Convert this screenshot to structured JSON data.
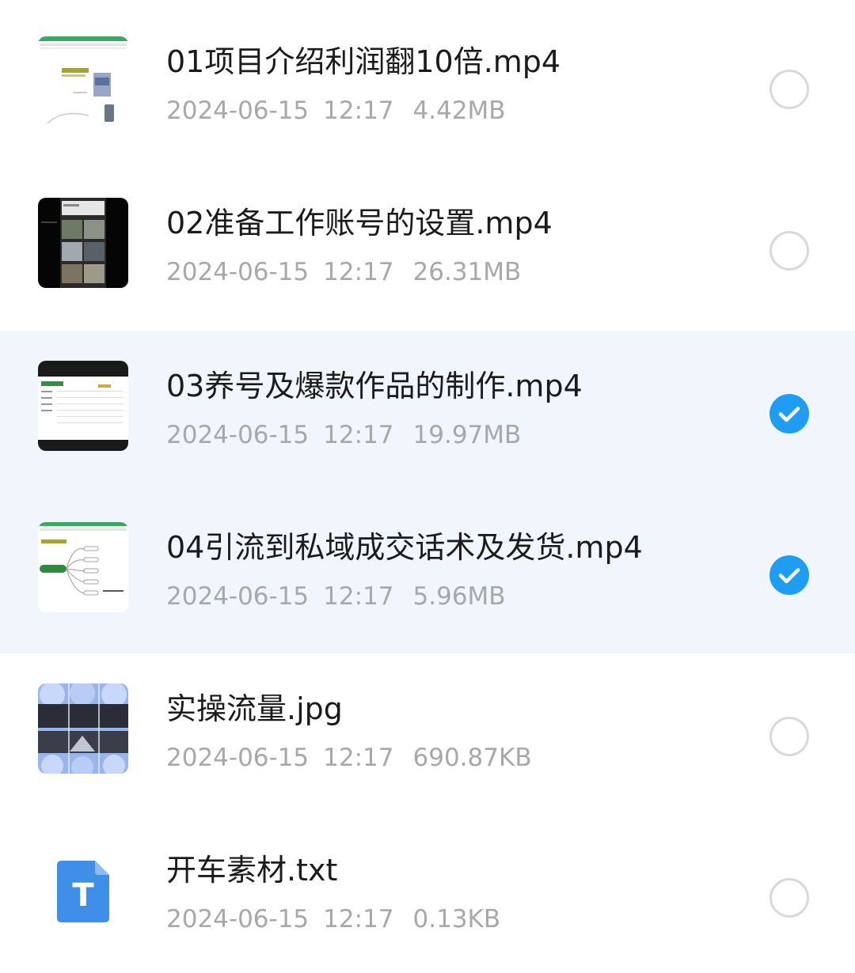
{
  "files": [
    {
      "name": "01项目介绍利润翻10倍.mp4",
      "date": "2024-06-15",
      "time": "12:17",
      "size": "4.42MB",
      "selected": false,
      "thumbnail": "spreadsheet-screenshot"
    },
    {
      "name": "02准备工作账号的设置.mp4",
      "date": "2024-06-15",
      "time": "12:17",
      "size": "26.31MB",
      "selected": false,
      "thumbnail": "phone-video-screenshot"
    },
    {
      "name": "03养号及爆款作品的制作.mp4",
      "date": "2024-06-15",
      "time": "12:17",
      "size": "19.97MB",
      "selected": true,
      "thumbnail": "desktop-table-screenshot"
    },
    {
      "name": "04引流到私域成交话术及发货.mp4",
      "date": "2024-06-15",
      "time": "12:17",
      "size": "5.96MB",
      "selected": true,
      "thumbnail": "mind-map-screenshot"
    },
    {
      "name": "实操流量.jpg",
      "date": "2024-06-15",
      "time": "12:17",
      "size": "690.87KB",
      "selected": false,
      "thumbnail": "video-grid-image"
    },
    {
      "name": "开车素材.txt",
      "date": "2024-06-15",
      "time": "12:17",
      "size": "0.13KB",
      "selected": false,
      "thumbnail": "txt-file-icon",
      "icon_letter": "T"
    }
  ],
  "colors": {
    "selected_row_bg": "#f1f6fc",
    "checkbox_checked": "#1e9df2",
    "checkbox_unchecked_border": "#d9d9d9",
    "name_text": "#1b1b1b",
    "meta_text": "#a8a8a8",
    "txt_icon": "#3f8ee8"
  }
}
